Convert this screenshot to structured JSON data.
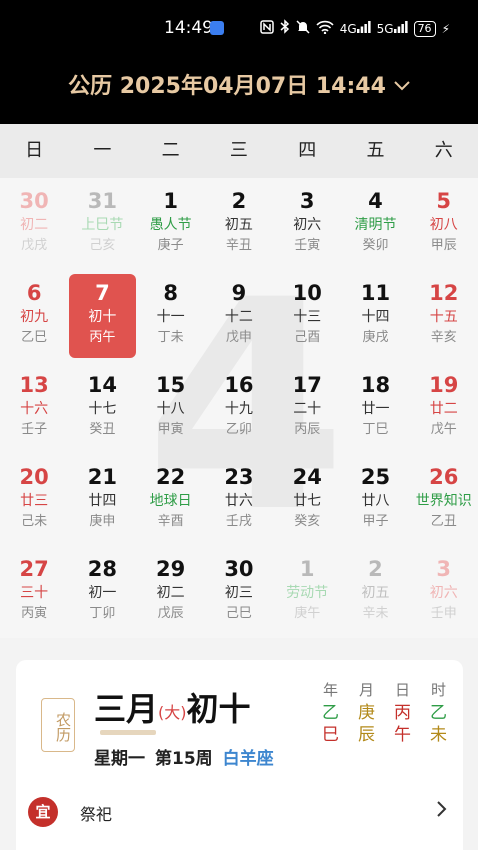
{
  "status_bar": {
    "time": "14:49",
    "icons": [
      "nfc-icon",
      "bluetooth-icon",
      "mute-icon",
      "wifi-icon",
      "signal-4g-icon",
      "signal-5g-icon"
    ],
    "signal_4g": "4G",
    "signal_5g": "5G",
    "battery": "76"
  },
  "header": {
    "title": "公历 2025年04月07日 14:44"
  },
  "weekdays": [
    "日",
    "一",
    "二",
    "三",
    "四",
    "五",
    "六"
  ],
  "big_month": "4",
  "days": [
    {
      "d": "30",
      "l1": "初二",
      "l2": "戊戌"
    },
    {
      "d": "31",
      "l1": "上巳节",
      "l2": "己亥"
    },
    {
      "d": "1",
      "l1": "愚人节",
      "l2": "庚子"
    },
    {
      "d": "2",
      "l1": "初五",
      "l2": "辛丑"
    },
    {
      "d": "3",
      "l1": "初六",
      "l2": "壬寅"
    },
    {
      "d": "4",
      "l1": "清明节",
      "l2": "癸卯"
    },
    {
      "d": "5",
      "l1": "初八",
      "l2": "甲辰"
    },
    {
      "d": "6",
      "l1": "初九",
      "l2": "乙巳"
    },
    {
      "d": "7",
      "l1": "初十",
      "l2": "丙午"
    },
    {
      "d": "8",
      "l1": "十一",
      "l2": "丁未"
    },
    {
      "d": "9",
      "l1": "十二",
      "l2": "戊申"
    },
    {
      "d": "10",
      "l1": "十三",
      "l2": "己酉"
    },
    {
      "d": "11",
      "l1": "十四",
      "l2": "庚戌"
    },
    {
      "d": "12",
      "l1": "十五",
      "l2": "辛亥"
    },
    {
      "d": "13",
      "l1": "十六",
      "l2": "壬子"
    },
    {
      "d": "14",
      "l1": "十七",
      "l2": "癸丑"
    },
    {
      "d": "15",
      "l1": "十八",
      "l2": "甲寅"
    },
    {
      "d": "16",
      "l1": "十九",
      "l2": "乙卯"
    },
    {
      "d": "17",
      "l1": "二十",
      "l2": "丙辰"
    },
    {
      "d": "18",
      "l1": "廿一",
      "l2": "丁巳"
    },
    {
      "d": "19",
      "l1": "廿二",
      "l2": "戊午"
    },
    {
      "d": "20",
      "l1": "廿三",
      "l2": "己未"
    },
    {
      "d": "21",
      "l1": "廿四",
      "l2": "庚申"
    },
    {
      "d": "22",
      "l1": "地球日",
      "l2": "辛酉"
    },
    {
      "d": "23",
      "l1": "廿六",
      "l2": "壬戌"
    },
    {
      "d": "24",
      "l1": "廿七",
      "l2": "癸亥"
    },
    {
      "d": "25",
      "l1": "廿八",
      "l2": "甲子"
    },
    {
      "d": "26",
      "l1": "世界知识",
      "l2": "乙丑"
    },
    {
      "d": "27",
      "l1": "三十",
      "l2": "丙寅"
    },
    {
      "d": "28",
      "l1": "初一",
      "l2": "丁卯"
    },
    {
      "d": "29",
      "l1": "初二",
      "l2": "戊辰"
    },
    {
      "d": "30",
      "l1": "初三",
      "l2": "己巳"
    },
    {
      "d": "1",
      "l1": "劳动节",
      "l2": "庚午"
    },
    {
      "d": "2",
      "l1": "初五",
      "l2": "辛未"
    },
    {
      "d": "3",
      "l1": "初六",
      "l2": "壬申"
    }
  ],
  "detail": {
    "seal": "农历",
    "lunar_month": "三月",
    "month_size": "(大)",
    "lunar_day": "初十",
    "weekday": "星期一",
    "week_no": "第15周",
    "zodiac": "白羊座",
    "ganzhi": [
      {
        "h": "年",
        "a": "乙",
        "b": "巳",
        "ca": "#2f9d47",
        "cb": "#c4302b"
      },
      {
        "h": "月",
        "a": "庚",
        "b": "辰",
        "ca": "#b38a1a",
        "cb": "#b38a1a"
      },
      {
        "h": "日",
        "a": "丙",
        "b": "午",
        "ca": "#c4302b",
        "cb": "#c4302b"
      },
      {
        "h": "时",
        "a": "乙",
        "b": "未",
        "ca": "#2f9d47",
        "cb": "#b38a1a"
      }
    ],
    "yi_badge": "宜",
    "yi_text": "祭祀"
  }
}
